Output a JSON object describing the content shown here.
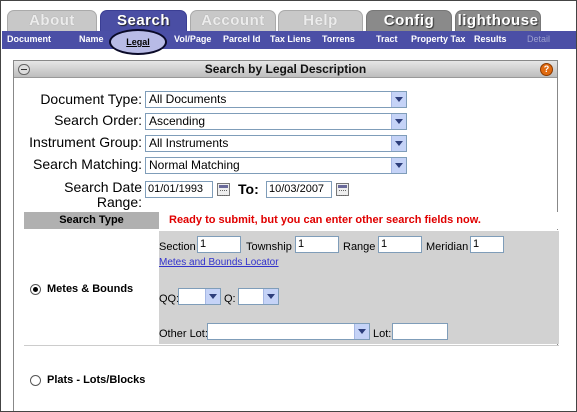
{
  "tabs": [
    {
      "label": "About"
    },
    {
      "label": "Search"
    },
    {
      "label": "Account"
    },
    {
      "label": "Help"
    },
    {
      "label": "Config"
    },
    {
      "label": "lighthouse"
    }
  ],
  "subnav": [
    "Document",
    "Name",
    "Legal",
    "Vol/Page",
    "Parcel Id",
    "Tax Liens",
    "Torrens",
    "Tract",
    "Property Tax",
    "Results",
    "Detail"
  ],
  "panel": {
    "title": "Search by Legal Description"
  },
  "form": {
    "document_type": {
      "label": "Document Type:",
      "value": "All Documents"
    },
    "search_order": {
      "label": "Search Order:",
      "value": "Ascending"
    },
    "instrument_group": {
      "label": "Instrument Group:",
      "value": "All Instruments"
    },
    "search_matching": {
      "label": "Search Matching:",
      "value": "Normal Matching"
    },
    "search_date": {
      "label_line1": "Search Date",
      "label_line2": "Range:",
      "from": "01/01/1993",
      "to_label": "To:",
      "to": "10/03/2007"
    }
  },
  "search_type": {
    "header": "Search Type",
    "message": "Ready to submit, but you can enter other search fields now."
  },
  "metes": {
    "label": "Metes & Bounds",
    "section_label": "Section",
    "section_value": "1",
    "township_label": "Township",
    "township_value": "1",
    "range_label": "Range",
    "range_value": "1",
    "meridian_label": "Meridian",
    "meridian_value": "1",
    "locator_link": "Metes and Bounds Locator",
    "qq_label": "QQ:",
    "q_label": "Q:",
    "other_lot_label": "Other Lot:",
    "lot_label": "Lot:"
  },
  "plats": {
    "label": "Plats - Lots/Blocks"
  }
}
